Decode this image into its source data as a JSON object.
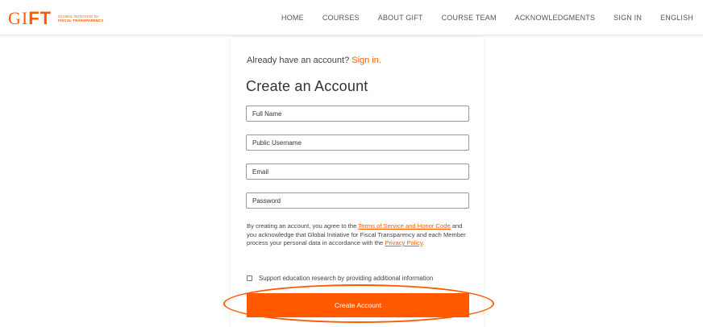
{
  "header": {
    "logo": {
      "text_main": "GIFT",
      "line1": "GLOBAL INITIATIVE for",
      "line2": "FISCAL TRANSPARENCY"
    },
    "nav": [
      {
        "label": "HOME"
      },
      {
        "label": "COURSES"
      },
      {
        "label": "ABOUT GIFT"
      },
      {
        "label": "COURSE TEAM"
      },
      {
        "label": "ACKNOWLEDGMENTS"
      },
      {
        "label": "SIGN IN"
      },
      {
        "label": "ENGLISH"
      }
    ]
  },
  "form": {
    "already_text": "Already have an account?",
    "sign_in_link": "Sign in.",
    "title": "Create an Account",
    "fields": {
      "full_name": {
        "placeholder": "Full Name"
      },
      "username": {
        "placeholder": "Public Username"
      },
      "email": {
        "placeholder": "Email"
      },
      "password": {
        "placeholder": "Password"
      }
    },
    "terms": {
      "pre": "By creating an account, you agree to the ",
      "terms_link": "Terms of Service and Honor Code",
      "mid": " and you acknowledge that Global Initiative for Fiscal Transparency and each Member process your personal data in accordance with the ",
      "privacy_link": "Privacy Policy",
      "post": "."
    },
    "checkbox_label": "Support education research by providing additional information",
    "submit_label": "Create Account"
  },
  "colors": {
    "accent": "#ff5a00"
  }
}
